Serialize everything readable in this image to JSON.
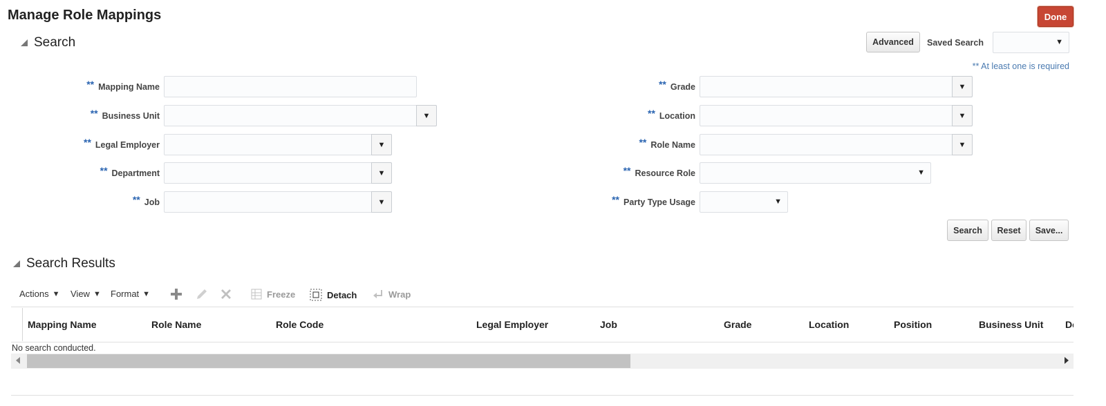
{
  "page": {
    "title": "Manage Role Mappings",
    "done_label": "Done"
  },
  "search": {
    "title": "Search",
    "advanced_label": "Advanced",
    "saved_search_label": "Saved Search",
    "saved_search_value": "",
    "required_hint": "** At least one is required",
    "required_marker": "**",
    "fields_left": [
      {
        "label": "Mapping Name",
        "value": ""
      },
      {
        "label": "Business Unit",
        "value": ""
      },
      {
        "label": "Legal Employer",
        "value": ""
      },
      {
        "label": "Department",
        "value": ""
      },
      {
        "label": "Job",
        "value": ""
      }
    ],
    "fields_right": [
      {
        "label": "Grade",
        "value": ""
      },
      {
        "label": "Location",
        "value": ""
      },
      {
        "label": "Role Name",
        "value": ""
      },
      {
        "label": "Resource Role",
        "value": ""
      },
      {
        "label": "Party Type Usage",
        "value": ""
      }
    ],
    "buttons": {
      "search": "Search",
      "reset": "Reset",
      "save": "Save..."
    }
  },
  "results": {
    "title": "Search Results",
    "toolbar": {
      "actions": "Actions",
      "view": "View",
      "format": "Format",
      "freeze": "Freeze",
      "detach": "Detach",
      "wrap": "Wrap"
    },
    "columns": [
      "Mapping Name",
      "Role Name",
      "Role Code",
      "Legal Employer",
      "Job",
      "Grade",
      "Location",
      "Position",
      "Business Unit",
      "De"
    ],
    "empty_text": "No search conducted."
  },
  "icons": {
    "dropdown": "chevron-down-icon",
    "add": "plus-icon",
    "edit": "pencil-icon",
    "delete": "x-icon",
    "freeze": "freeze-icon",
    "detach": "detach-icon",
    "wrap": "wrap-icon"
  },
  "colors": {
    "done_button": "#c74634",
    "required_marker": "#2a64b1"
  }
}
